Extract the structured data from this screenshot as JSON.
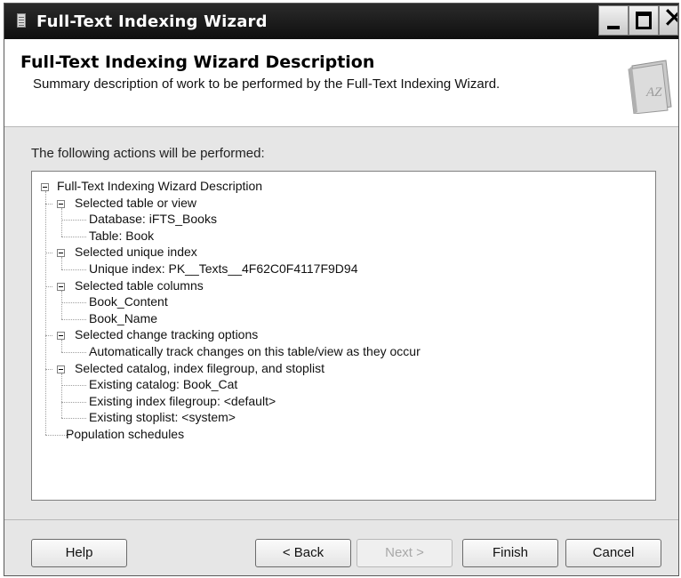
{
  "window": {
    "title": "Full-Text Indexing Wizard"
  },
  "header": {
    "title": "Full-Text Indexing Wizard Description",
    "subtitle": "Summary description of work to be performed by the Full-Text Indexing Wizard.",
    "icon": "book-az-icon",
    "icon_text": "AZ"
  },
  "body": {
    "actions_label": "The following actions will be performed:",
    "tree": {
      "root": "Full-Text Indexing Wizard Description",
      "nodes": [
        {
          "label": "Selected table or view",
          "children": [
            "Database: iFTS_Books",
            "Table: Book"
          ]
        },
        {
          "label": "Selected unique index",
          "children": [
            "Unique index: PK__Texts__4F62C0F4117F9D94"
          ]
        },
        {
          "label": "Selected table columns",
          "children": [
            "Book_Content",
            "Book_Name"
          ]
        },
        {
          "label": "Selected change tracking options",
          "children": [
            "Automatically track changes on this table/view as they occur"
          ]
        },
        {
          "label": "Selected catalog, index filegroup, and stoplist",
          "children": [
            "Existing catalog: Book_Cat",
            "Existing index filegroup: <default>",
            "Existing stoplist: <system>"
          ]
        },
        {
          "label": "Population schedules",
          "children": []
        }
      ]
    }
  },
  "buttons": {
    "help": "Help",
    "back": "< Back",
    "next": "Next >",
    "finish": "Finish",
    "cancel": "Cancel"
  }
}
